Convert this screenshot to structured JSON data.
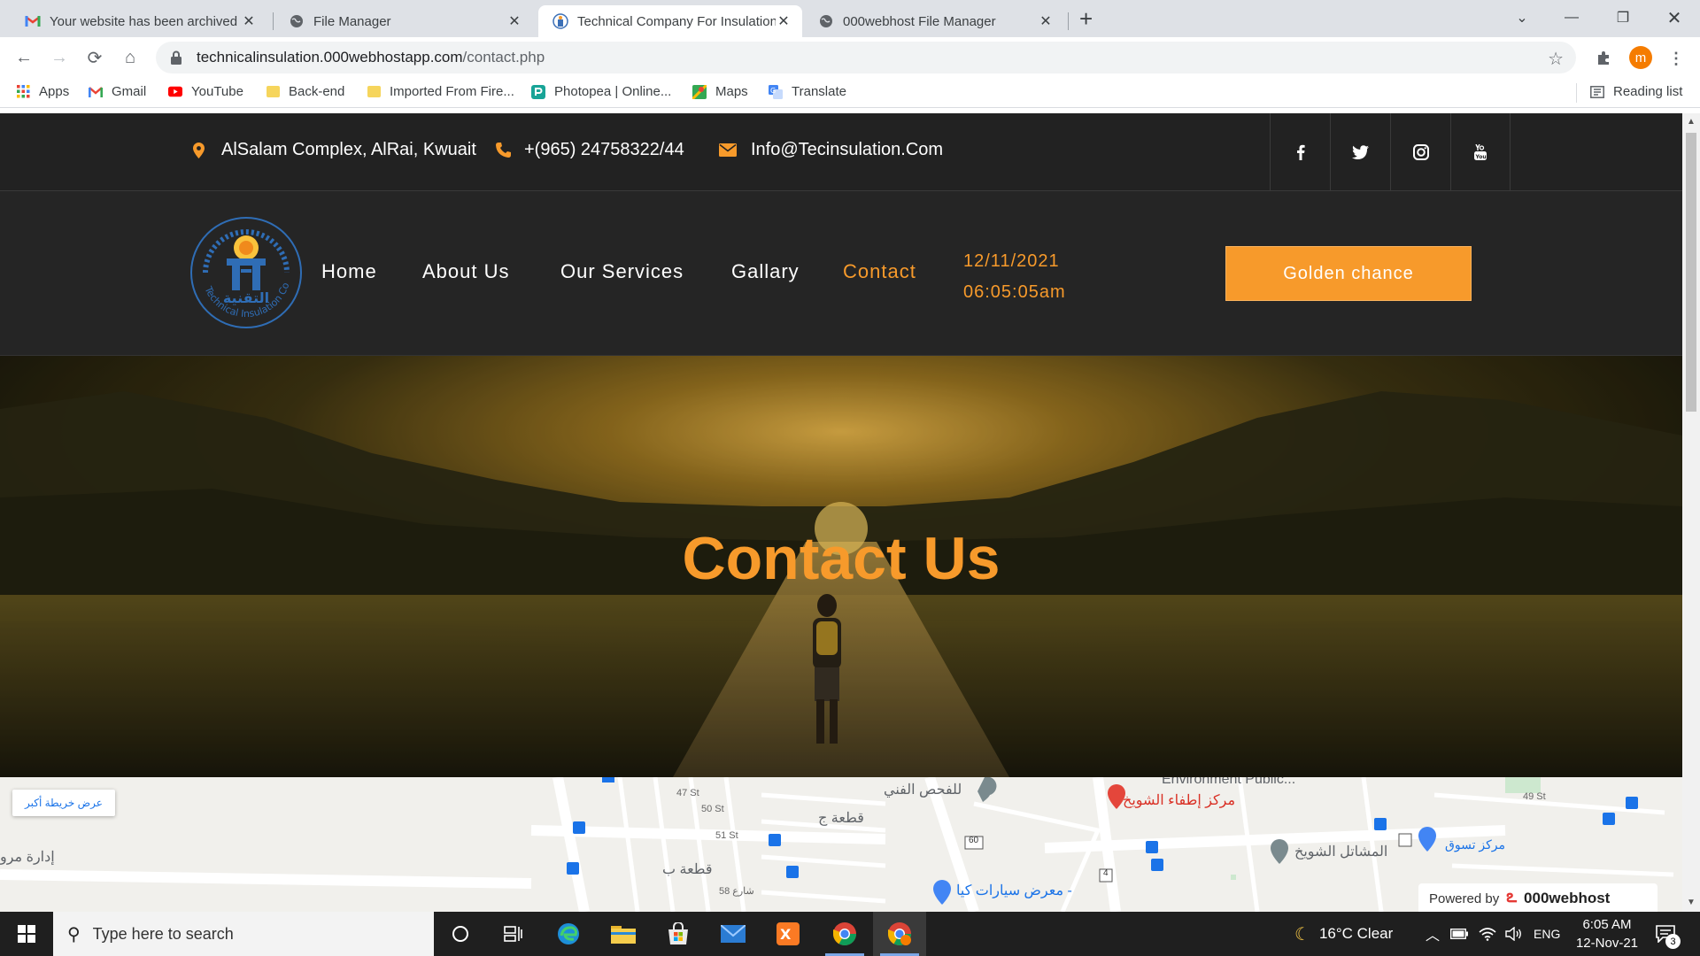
{
  "browser": {
    "tabs": [
      {
        "title": "Your website has been archived",
        "icon": "gmail-icon",
        "active": false
      },
      {
        "title": "File Manager",
        "icon": "globe-icon",
        "active": false
      },
      {
        "title": "Technical Company For Insulation",
        "icon": "site-favicon",
        "active": true
      },
      {
        "title": "000webhost File Manager",
        "icon": "globe-icon",
        "active": false
      }
    ],
    "url_host": "technicalinsulation.000webhostapp.com",
    "url_path": "/contact.php",
    "profile_initial": "m",
    "bookmarks": [
      {
        "label": "Apps",
        "icon": "apps-grid-icon"
      },
      {
        "label": "Gmail",
        "icon": "gmail-icon"
      },
      {
        "label": "YouTube",
        "icon": "youtube-icon"
      },
      {
        "label": "Back-end",
        "icon": "folder-icon"
      },
      {
        "label": "Imported From Fire...",
        "icon": "folder-icon"
      },
      {
        "label": "Photopea | Online...",
        "icon": "photopea-icon"
      },
      {
        "label": "Maps",
        "icon": "maps-icon"
      },
      {
        "label": "Translate",
        "icon": "translate-icon"
      }
    ],
    "reading_list": "Reading list"
  },
  "site": {
    "address": "AlSalam Complex, AlRai, Kwuait",
    "phone": "+(965) 24758322/44",
    "email": "Info@Tecinsulation.Com",
    "social": [
      "facebook-icon",
      "twitter-icon",
      "instagram-icon",
      "youtube-icon"
    ],
    "nav": [
      "Home",
      "About Us",
      "Our Services",
      "Gallary",
      "Contact"
    ],
    "active_nav": "Contact",
    "date": "12/11/2021",
    "time": "06:05:05am",
    "cta": "Golden chance",
    "hero_title": "Contact Us",
    "accent_color": "#f79a2b",
    "logo_arabic": "التقنية",
    "logo_text": "Technical Insulation Co."
  },
  "map": {
    "bigger_map_link": "عرض خريطة أكبر",
    "labels": {
      "fire_center": "مركز إطفاء الشويخ",
      "env_public": "Environment Public...",
      "inspection": "للفحص الفني",
      "shuwaikh_warehouses": "المشاتل الشويخ",
      "shopping": "مركز تسوق",
      "car_showroom": "معرض سيارات كيا -",
      "piece_j": "قطعة ج",
      "piece_b": "قطعة ب",
      "admin": "إدارة مرو",
      "st47": "47 St",
      "st49": "49 St",
      "st50": "50 St",
      "st51": "51 St",
      "st58": "58 شارع",
      "road60": "60",
      "road4": "4"
    },
    "powered_by": "Powered by",
    "powered_brand": "000webhost"
  },
  "taskbar": {
    "search_placeholder": "Type here to search",
    "weather": "16°C  Clear",
    "language": "ENG",
    "time": "6:05 AM",
    "date": "12-Nov-21",
    "notification_count": "3"
  }
}
